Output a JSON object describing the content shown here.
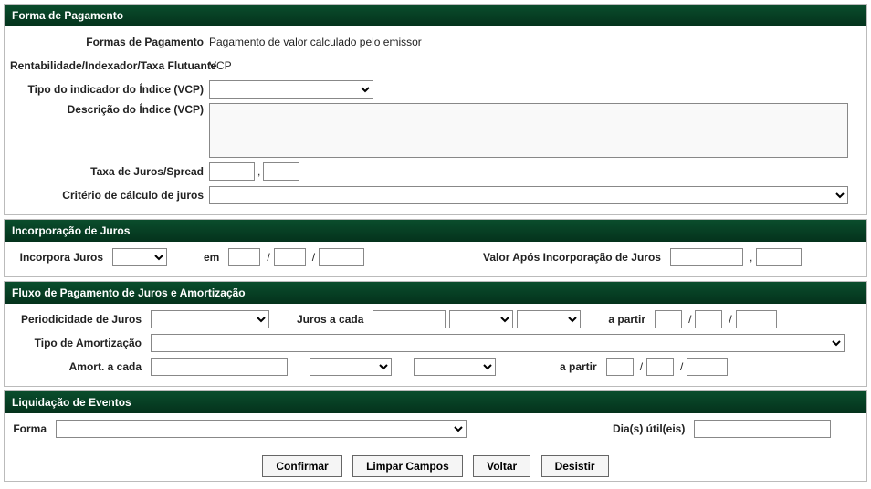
{
  "forma_pagamento": {
    "header": "Forma de Pagamento",
    "labels": {
      "formas_pagamento": "Formas de Pagamento",
      "rentabilidade": "Rentabilidade/Indexador/Taxa Flutuante",
      "tipo_indicador": "Tipo do indicador do Índice (VCP)",
      "descricao_indice": "Descrição do Índice (VCP)",
      "taxa_juros": "Taxa de Juros/Spread",
      "criterio_calculo": "Critério de cálculo de juros"
    },
    "values": {
      "formas_pagamento": "Pagamento de valor calculado pelo emissor",
      "rentabilidade": "VCP",
      "tipo_indicador": "",
      "descricao_indice": "",
      "taxa_juros_a": "",
      "taxa_juros_b": "",
      "criterio_calculo": ""
    },
    "separators": {
      "comma": ","
    }
  },
  "incorporacao": {
    "header": "Incorporação de Juros",
    "labels": {
      "incorpora": "Incorpora Juros",
      "em": "em",
      "valor_apos": "Valor Após Incorporação de Juros"
    },
    "values": {
      "incorpora": "",
      "data_d": "",
      "data_m": "",
      "data_y": "",
      "valor_a": "",
      "valor_b": ""
    },
    "separators": {
      "slash": "/",
      "comma": ","
    }
  },
  "fluxo": {
    "header": "Fluxo de Pagamento de Juros e Amortização",
    "labels": {
      "periodicidade": "Periodicidade de Juros",
      "juros_cada": "Juros a cada",
      "a_partir": "a partir",
      "tipo_amort": "Tipo de Amortização",
      "amort_cada": "Amort. a cada"
    },
    "values": {
      "periodicidade": "",
      "juros_cada_n": "",
      "juros_sel1": "",
      "juros_sel2": "",
      "juros_data_d": "",
      "juros_data_m": "",
      "juros_data_y": "",
      "tipo_amort": "",
      "amort_cada_n": "",
      "amort_sel1": "",
      "amort_sel2": "",
      "amort_data_d": "",
      "amort_data_m": "",
      "amort_data_y": ""
    },
    "separators": {
      "slash": "/"
    }
  },
  "liquidacao": {
    "header": "Liquidação de Eventos",
    "labels": {
      "forma": "Forma",
      "dias_util": "Dia(s) útil(eis)"
    },
    "values": {
      "forma": "",
      "dias_util": ""
    }
  },
  "buttons": {
    "confirmar": "Confirmar",
    "limpar": "Limpar Campos",
    "voltar": "Voltar",
    "desistir": "Desistir"
  }
}
